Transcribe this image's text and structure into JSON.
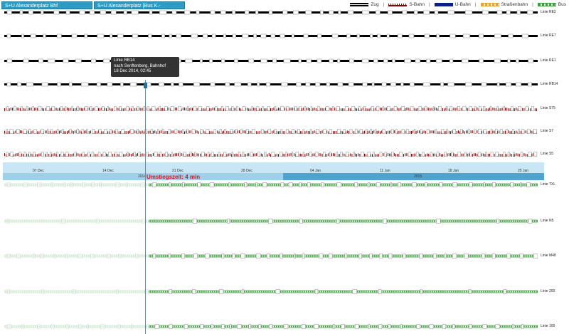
{
  "tabs": [
    "S+U Alexanderplatz Bhf",
    "S+U Alexanderplatz [Bus K.-Liebknecht-Str]"
  ],
  "legend": [
    {
      "label": "Zug",
      "icon": "zug-swatch"
    },
    {
      "label": "S-Bahn",
      "icon": "sbahn-swatch"
    },
    {
      "label": "U-Bahn",
      "icon": "ubahn-swatch"
    },
    {
      "label": "Straßenbahn",
      "icon": "tram-swatch"
    },
    {
      "label": "Bus",
      "icon": "bus-swatch"
    }
  ],
  "lines": {
    "re2": "Linie RE2",
    "re7": "Linie RE7",
    "re1": "Linie RE1",
    "rb14": "Linie RB14",
    "s75": "Linie S75",
    "s7": "Linie S7",
    "s5": "Linie S5",
    "txl": "Linie TXL",
    "n5": "Linie N5",
    "m48": "Linie M48",
    "l200": "Linie 200",
    "l100": "Linie 100"
  },
  "axis": {
    "dates": [
      "07 Dec",
      "14 Dec",
      "21 Dec",
      "28 Dec",
      "04 Jan",
      "11 Jan",
      "18 Jan",
      "25 Jan"
    ],
    "years": [
      "2014",
      "2015"
    ]
  },
  "transfer": "Umstiegszeit: 4 min",
  "tooltip": {
    "line1": "Linie RB14",
    "line2": "nach Senftenberg, Bahnhof",
    "line3": "18 Dec 2014, 02:45"
  },
  "colors": {
    "zug": "#000000",
    "sbahn": "#8b0000",
    "ubahn": "#0b1f8a",
    "tram": "#f0a030",
    "bus": "#3aa13a"
  }
}
